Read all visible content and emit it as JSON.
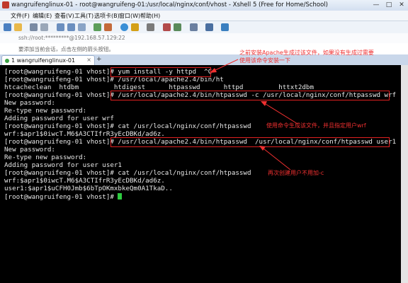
{
  "window": {
    "title": "wangruifenglinux-01 - root@wangruifeng-01:/usr/local/nginx/conf/vhost - Xshell 5 (Free for Home/School)",
    "controls": [
      "—",
      "□",
      "✕"
    ]
  },
  "menu": [
    "文件(F)",
    "编辑(E)",
    "查看(V)",
    "工具(T)",
    "选项卡(B)",
    "窗口(W)",
    "帮助(H)"
  ],
  "address": "ssh://root:*********@192.168.57.129:22",
  "hint": "要添加当前会话，点击左侧的箭头按钮。",
  "tab": {
    "label": "1 wangruifenglinux-01",
    "close": "×",
    "add": "+"
  },
  "terminal": {
    "lines": [
      "[root@wangruifeng-01 vhost]# yum install -y httpd  ^C",
      "[root@wangruifeng-01 vhost]# /usr/local/apache2.4/bin/ht",
      "htcacheclean  htdbm         htdigest      htpasswd      httpd         httxt2dbm",
      "[root@wangruifeng-01 vhost]# /usr/local/apache2.4/bin/htpasswd -c /usr/local/nginx/conf/htpasswd wrf",
      "New password:",
      "Re-type new password:",
      "Adding password for user wrf",
      "[root@wangruifeng-01 vhost]# cat /usr/local/nginx/conf/htpasswd",
      "wrf:$apr1$0iwcT.M6$A3CTIfrR3yEcDBKd/ad6z.",
      "[root@wangruifeng-01 vhost]# /usr/local/apache2.4/bin/htpasswd  /usr/local/nginx/conf/htpasswd user1",
      "New password:",
      "Re-type new password:",
      "Adding password for user user1",
      "[root@wangruifeng-01 vhost]# cat /usr/local/nginx/conf/htpasswd",
      "wrf:$apr1$0iwcT.M6$A3CTIfrR3yEcDBKd/ad6z.",
      "user1:$apr1$uCFH0Jmb$6bTpOKmxbkeQm0A1TkaD..",
      "[root@wangruifeng-01 vhost]# "
    ]
  },
  "annotations": {
    "a1_line1": "之前安装Apache生成过该文件，如果没有生成过需要",
    "a1_line2": "使用该命令安装一下",
    "a2": "使用命令生成该文件，并且指定用户wrf",
    "a3": "再次创建用户不用加-c"
  },
  "colors": {
    "annotation": "#f03030",
    "cursor": "#2ecc40",
    "terminal_bg": "#000000",
    "terminal_fg": "#e8e8e8"
  }
}
